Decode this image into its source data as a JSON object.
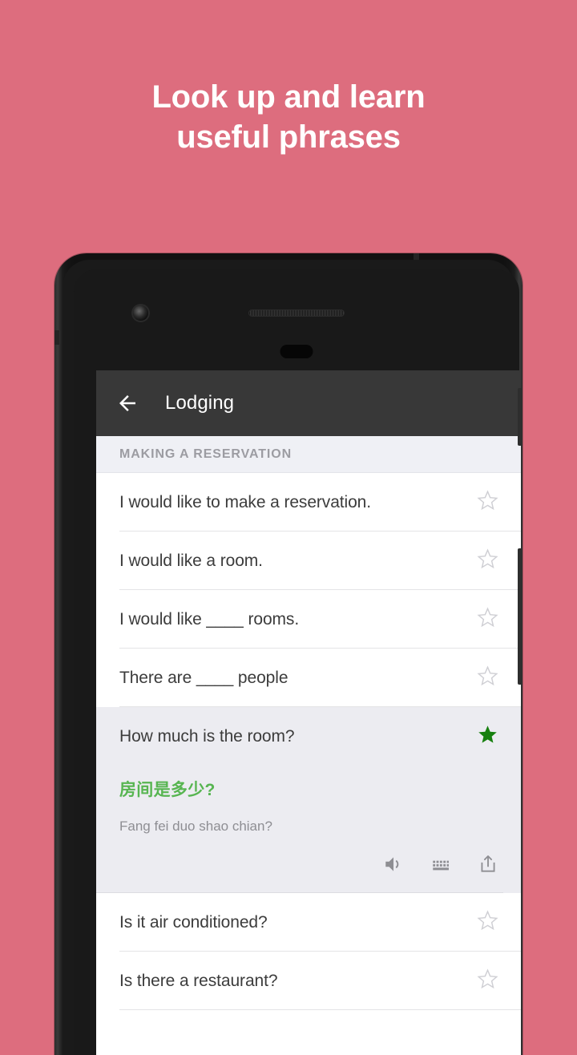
{
  "promo": {
    "headline_line1": "Look up and learn",
    "headline_line2": "useful phrases",
    "background_color": "#DD6D7E",
    "text_color": "#FFFFFF"
  },
  "app": {
    "appbar": {
      "back_icon": "arrow-back-icon",
      "title": "Lodging",
      "background_color": "#383838",
      "title_color": "#FFFFFF"
    },
    "section": {
      "label": "MAKING A RESERVATION",
      "background_color": "#EFF0F5",
      "label_color": "#9C9CA2"
    },
    "colors": {
      "favorite_star_active": "#17800F",
      "favorite_star_inactive": "#CFCFD4",
      "translation_green": "#57B551",
      "row_background": "#FFFFFF",
      "expanded_background": "#ECECF1",
      "primary_text": "#3C3C3C",
      "secondary_text": "#8E8E93"
    },
    "phrases": [
      {
        "text": "I would like to make a reservation.",
        "favorited": false,
        "expanded": false
      },
      {
        "text": "I would like a room.",
        "favorited": false,
        "expanded": false
      },
      {
        "text": "I would like ____ rooms.",
        "favorited": false,
        "expanded": false
      },
      {
        "text": "There are ____ people",
        "favorited": false,
        "expanded": false
      },
      {
        "text": "How much is the room?",
        "favorited": true,
        "expanded": true,
        "translation": "房间是多少?",
        "romanization": "Fang fei duo shao chian?",
        "actions": [
          {
            "name": "speaker-icon",
            "label": "Play audio"
          },
          {
            "name": "keyboard-icon",
            "label": "Show keyboard"
          },
          {
            "name": "share-icon",
            "label": "Share"
          }
        ]
      },
      {
        "text": "Is it air conditioned?",
        "favorited": false,
        "expanded": false
      },
      {
        "text": "Is there a restaurant?",
        "favorited": false,
        "expanded": false
      }
    ]
  },
  "device": {
    "front_camera": "front-camera",
    "earpiece": "earpiece-speaker",
    "sensor": "proximity-sensor",
    "power_button": "power-button",
    "volume_button": "volume-button"
  }
}
